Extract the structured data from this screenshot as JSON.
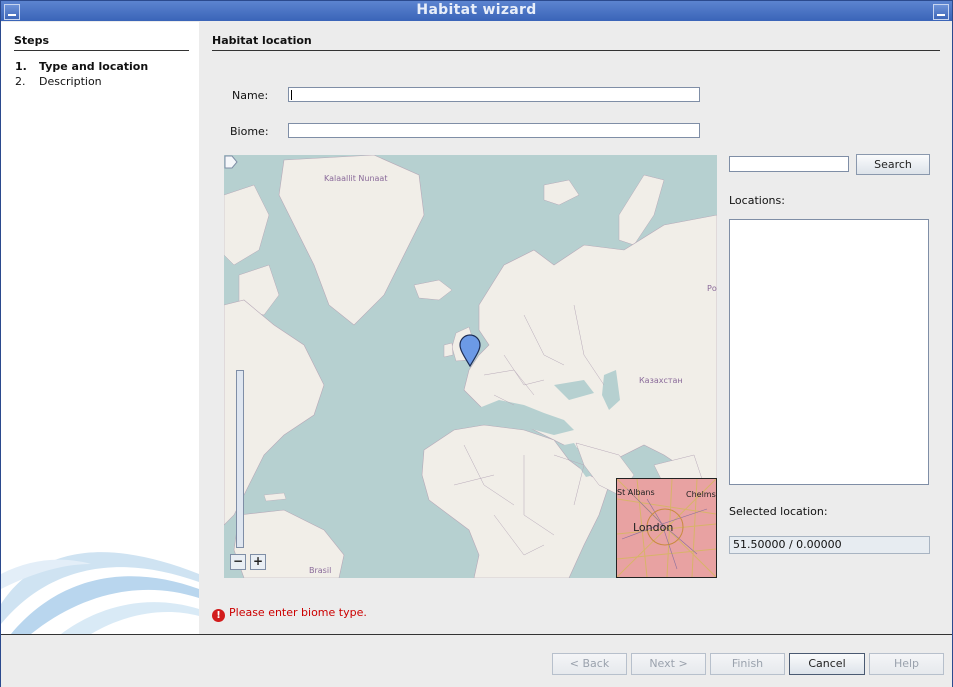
{
  "window": {
    "title": "Habitat wizard"
  },
  "steps": {
    "header": "Steps",
    "items": [
      {
        "num": "1.",
        "label": "Type and location"
      },
      {
        "num": "2.",
        "label": "Description"
      }
    ]
  },
  "panel": {
    "header": "Habitat location",
    "name_label": "Name:",
    "name_value": "",
    "biome_label": "Biome:",
    "biome_value": ""
  },
  "map": {
    "labels": {
      "greenland": "Kalaallit Nunaat",
      "russia": "Ро",
      "kazakhstan": "Казахстан",
      "brazil": "Brasil"
    },
    "inset": {
      "st_albans": "St Albans",
      "chelmsford": "Chelms",
      "london": "London"
    },
    "zoom_out": "−",
    "zoom_in": "+"
  },
  "search": {
    "value": "",
    "button": "Search",
    "locations_label": "Locations:",
    "locations": [],
    "selected_label": "Selected location:",
    "selected_value": "51.50000 / 0.00000"
  },
  "error": {
    "icon": "!",
    "message": "Please enter biome type."
  },
  "buttons": {
    "back": "< Back",
    "next": "Next >",
    "finish": "Finish",
    "cancel": "Cancel",
    "help": "Help"
  },
  "colors": {
    "titlebar": "#3a64b8",
    "error": "#cc0000",
    "water": "#b6d0d0",
    "land": "#f1eee8",
    "marker": "#6c9ae6"
  }
}
